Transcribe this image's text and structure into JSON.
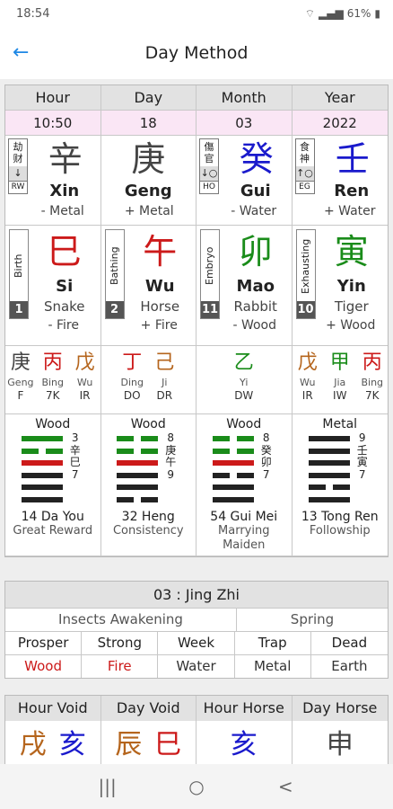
{
  "status": {
    "time": "18:54",
    "battery": "61%"
  },
  "app_bar": {
    "title": "Day Method"
  },
  "headers": [
    "Hour",
    "Day",
    "Month",
    "Year"
  ],
  "times": [
    "10:50",
    "18",
    "03",
    "2022"
  ],
  "stems": [
    {
      "char": "辛",
      "color": "#444444",
      "pinyin": "Xin",
      "element": "- Metal",
      "god": "劫财",
      "god_abbr": "RW",
      "arrow": "↓"
    },
    {
      "char": "庚",
      "color": "#444444",
      "pinyin": "Geng",
      "element": "+ Metal"
    },
    {
      "char": "癸",
      "color": "#1a1acc",
      "pinyin": "Gui",
      "element": "- Water",
      "god": "傷官",
      "god_abbr": "HO",
      "arrow": "↓○"
    },
    {
      "char": "壬",
      "color": "#1a1acc",
      "pinyin": "Ren",
      "element": "+ Water",
      "god": "食神",
      "god_abbr": "EG",
      "arrow": "↑○"
    }
  ],
  "branches": [
    {
      "stage": "Birth",
      "stage_num": "1",
      "char": "巳",
      "color": "#cc1a1a",
      "pinyin": "Si",
      "animal": "Snake",
      "element": "- Fire"
    },
    {
      "stage": "Bathing",
      "stage_num": "2",
      "char": "午",
      "color": "#cc1a1a",
      "pinyin": "Wu",
      "animal": "Horse",
      "element": "+ Fire"
    },
    {
      "stage": "Embryo",
      "stage_num": "11",
      "char": "卯",
      "color": "#1a8c1a",
      "pinyin": "Mao",
      "animal": "Rabbit",
      "element": "- Wood"
    },
    {
      "stage": "Exhausting",
      "stage_num": "10",
      "char": "寅",
      "color": "#1a8c1a",
      "pinyin": "Yin",
      "animal": "Tiger",
      "element": "+ Wood"
    }
  ],
  "hidden_stems": [
    [
      {
        "char": "庚",
        "color": "#444444",
        "name": "Geng",
        "god": "F"
      },
      {
        "char": "丙",
        "color": "#cc1a1a",
        "name": "Bing",
        "god": "7K"
      },
      {
        "char": "戊",
        "color": "#b5651d",
        "name": "Wu",
        "god": "IR"
      }
    ],
    [
      {
        "char": "丁",
        "color": "#cc1a1a",
        "name": "Ding",
        "god": "DO"
      },
      {
        "char": "己",
        "color": "#b5651d",
        "name": "Ji",
        "god": "DR"
      }
    ],
    [
      {
        "char": "乙",
        "color": "#1a8c1a",
        "name": "Yi",
        "god": "DW"
      }
    ],
    [
      {
        "char": "戊",
        "color": "#b5651d",
        "name": "Wu",
        "god": "IR"
      },
      {
        "char": "甲",
        "color": "#1a8c1a",
        "name": "Jia",
        "god": "IW"
      },
      {
        "char": "丙",
        "color": "#cc1a1a",
        "name": "Bing",
        "god": "7K"
      }
    ]
  ],
  "hexagrams": [
    {
      "element": "Wood",
      "nums": [
        "3",
        "辛",
        "巳",
        "7"
      ],
      "name": "14 Da You",
      "english": "Great Reward",
      "lines": [
        [
          "yang",
          "#1a8c1a"
        ],
        [
          "yin",
          "#1a8c1a"
        ],
        [
          "yang",
          "#cc1a1a"
        ],
        [
          "yang",
          "#222222"
        ],
        [
          "yang",
          "#222222"
        ],
        [
          "yang",
          "#222222"
        ]
      ]
    },
    {
      "element": "Wood",
      "nums": [
        "8",
        "庚",
        "午",
        "9"
      ],
      "name": "32 Heng",
      "english": "Consistency",
      "lines": [
        [
          "yin",
          "#1a8c1a"
        ],
        [
          "yin",
          "#1a8c1a"
        ],
        [
          "yang",
          "#cc1a1a"
        ],
        [
          "yang",
          "#222222"
        ],
        [
          "yang",
          "#222222"
        ],
        [
          "yin",
          "#222222"
        ]
      ]
    },
    {
      "element": "Wood",
      "nums": [
        "8",
        "癸",
        "卯",
        "7"
      ],
      "name": "54 Gui Mei",
      "english": "Marrying Maiden",
      "lines": [
        [
          "yin",
          "#1a8c1a"
        ],
        [
          "yin",
          "#1a8c1a"
        ],
        [
          "yang",
          "#cc1a1a"
        ],
        [
          "yin",
          "#222222"
        ],
        [
          "yang",
          "#222222"
        ],
        [
          "yang",
          "#222222"
        ]
      ]
    },
    {
      "element": "Metal",
      "nums": [
        "9",
        "壬",
        "寅",
        "7"
      ],
      "name": "13 Tong Ren",
      "english": "Followship",
      "lines": [
        [
          "yang",
          "#222222"
        ],
        [
          "yang",
          "#222222"
        ],
        [
          "yang",
          "#222222"
        ],
        [
          "yang",
          "#222222"
        ],
        [
          "yin",
          "#222222"
        ],
        [
          "yang",
          "#222222"
        ]
      ]
    }
  ],
  "jing_zhi": {
    "title": "03 : Jing Zhi",
    "solar_term": "Insects Awakening",
    "season": "Spring",
    "phases": [
      "Prosper",
      "Strong",
      "Week",
      "Trap",
      "Dead"
    ],
    "elements": [
      "Wood",
      "Fire",
      "Water",
      "Metal",
      "Earth"
    ],
    "element_colors": [
      "#cc1a1a",
      "#cc1a1a",
      "#333333",
      "#333333",
      "#333333"
    ]
  },
  "voids": {
    "headers": [
      "Hour Void",
      "Day Void",
      "Hour Horse",
      "Day Horse"
    ],
    "values": [
      "戌亥",
      "辰巳",
      "亥",
      "申"
    ],
    "colors": [
      [
        "#b5651d",
        "#1a1acc"
      ],
      [
        "#b5651d",
        "#cc1a1a"
      ],
      [
        "#1a1acc"
      ],
      [
        "#444444"
      ]
    ]
  },
  "nav": {
    "recents": "|||",
    "home": "○",
    "back": "<"
  }
}
